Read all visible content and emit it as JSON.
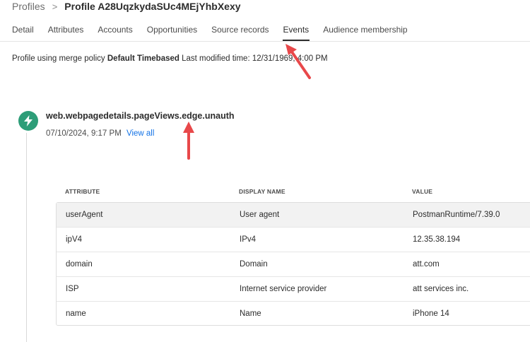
{
  "breadcrumb": {
    "parent": "Profiles",
    "separator": ">",
    "current": "Profile A28UqzkydaSUc4MEjYhbXexy"
  },
  "tabs": [
    {
      "label": "Detail",
      "active": false
    },
    {
      "label": "Attributes",
      "active": false
    },
    {
      "label": "Accounts",
      "active": false
    },
    {
      "label": "Opportunities",
      "active": false
    },
    {
      "label": "Source records",
      "active": false
    },
    {
      "label": "Events",
      "active": true
    },
    {
      "label": "Audience membership",
      "active": false
    }
  ],
  "merge_info": {
    "prefix": "Profile using merge policy",
    "policy": "Default Timebased",
    "modified_label": "Last modified time:",
    "modified_value": "12/31/1969, 4:00 PM"
  },
  "event": {
    "icon": "lightning-bolt-icon",
    "icon_color": "#2d9d78",
    "title": "web.webpagedetails.pageViews.edge.unauth",
    "timestamp": "07/10/2024, 9:17 PM",
    "view_all": "View all"
  },
  "table": {
    "headers": {
      "attribute": "ATTRIBUTE",
      "display_name": "DISPLAY NAME",
      "value": "VALUE"
    },
    "rows": [
      {
        "attribute": "userAgent",
        "display_name": "User agent",
        "value": "PostmanRuntime/7.39.0"
      },
      {
        "attribute": "ipV4",
        "display_name": "IPv4",
        "value": "12.35.38.194"
      },
      {
        "attribute": "domain",
        "display_name": "Domain",
        "value": "att.com"
      },
      {
        "attribute": "ISP",
        "display_name": "Internet service provider",
        "value": "att services inc."
      },
      {
        "attribute": "name",
        "display_name": "Name",
        "value": "iPhone 14"
      }
    ]
  },
  "annotation_color": "#e8484a"
}
